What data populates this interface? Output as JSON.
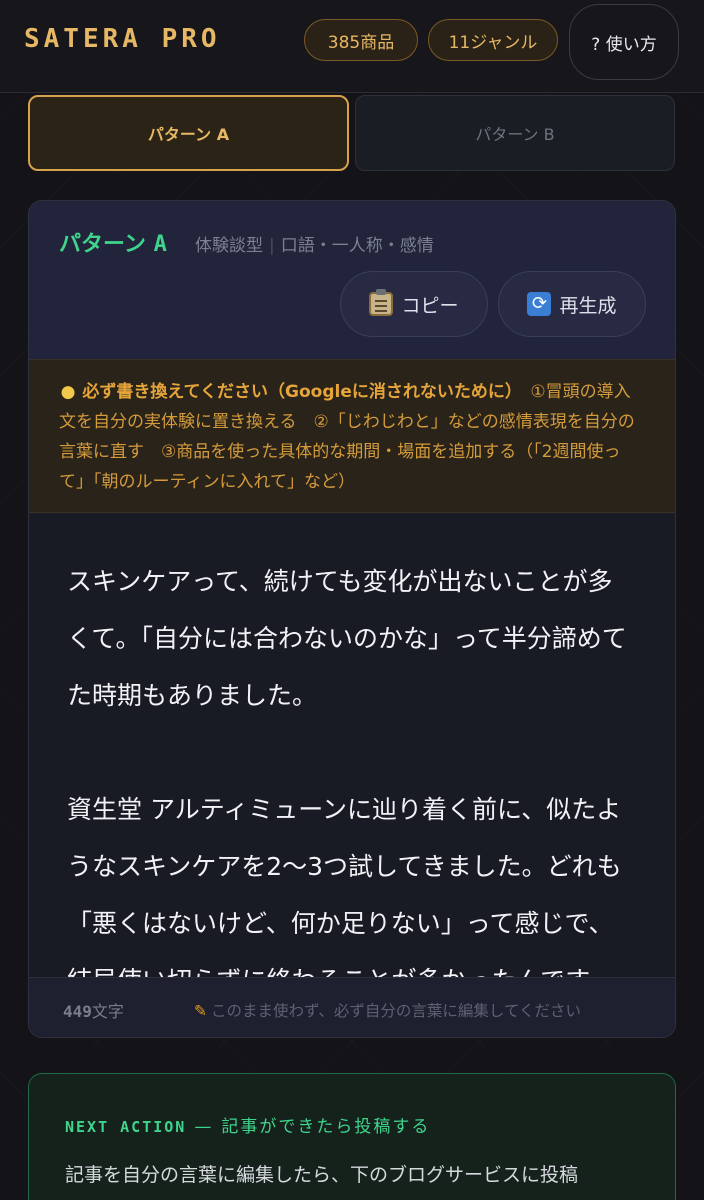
{
  "header": {
    "logo": "SATERA PRO",
    "product_count": "385商品",
    "genre_count": "11ジャンル",
    "help_label": "? 使い方"
  },
  "tabs": [
    {
      "label": "パターン A",
      "active": true
    },
    {
      "label": "パターン B",
      "active": false
    }
  ],
  "pattern": {
    "title_jp": "パターン",
    "title_letter": "A",
    "type": "体験談型",
    "style": "口語・一人称・感情",
    "copy_label": "コピー",
    "regen_label": "再生成"
  },
  "notice": {
    "lead": "必ず書き換えてください（Googleに消されないために）",
    "body": "①冒頭の導入文を自分の実体験に置き換える　②「じわじわと」などの感情表現を自分の言葉に直す　③商品を使った具体的な期間・場面を追加する（「2週間使って」「朝のルーティンに入れて」など）"
  },
  "article": {
    "paragraphs": [
      "スキンケアって、続けても変化が出ないことが多くて。「自分には合わないのかな」って半分諦めてた時期もありました。",
      "資生堂 アルティミューンに辿り着く前に、似たようなスキンケアを2〜3つ試してきました。どれも「悪くはないけど、何か足りない」って感じで、結局使い切らずに終わることが多かったんです。"
    ]
  },
  "footer": {
    "char_count": "449",
    "char_unit": "文字",
    "warning": "このまま使わず、必ず自分の言葉に編集してください"
  },
  "next_action": {
    "tag": "NEXT ACTION",
    "dash": "—",
    "title": "記事ができたら投稿する",
    "body": "記事を自分の言葉に編集したら、下のブログサービスに投稿"
  },
  "colors": {
    "accent_gold": "#e6b866",
    "accent_green": "#3fd48c",
    "notice_orange": "#d49b3c"
  }
}
